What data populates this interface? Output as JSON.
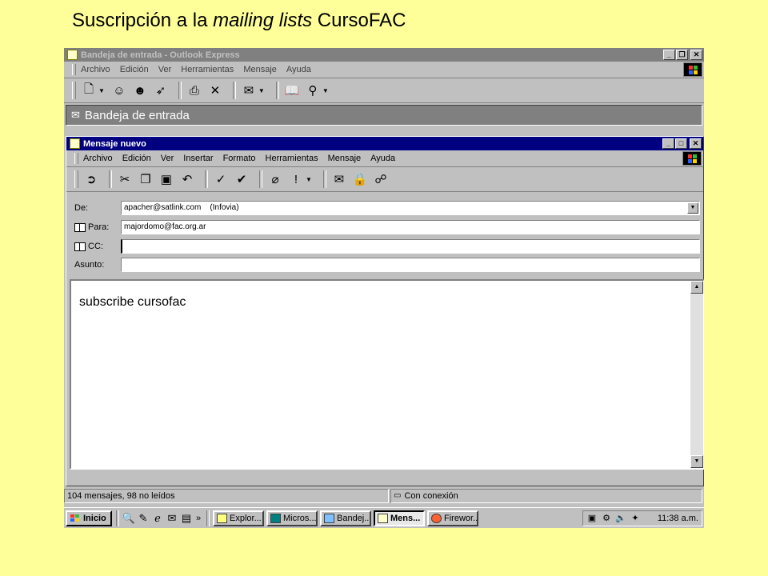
{
  "slide": {
    "title_pre": "Suscripción a la ",
    "title_italic": "mailing lists",
    "title_post": " CursoFAC"
  },
  "outer_window": {
    "title": "Bandeja de entrada - Outlook Express",
    "menu": [
      "Archivo",
      "Edición",
      "Ver",
      "Herramientas",
      "Mensaje",
      "Ayuda"
    ],
    "toolbar_icons": [
      "new-message-icon",
      "reply-icon",
      "reply-all-icon",
      "forward-icon",
      "print-icon",
      "delete-icon",
      "send-receive-icon",
      "address-book-icon",
      "find-icon"
    ],
    "folder_title": "Bandeja de entrada"
  },
  "compose_window": {
    "title": "Mensaje nuevo",
    "menu": [
      "Archivo",
      "Edición",
      "Ver",
      "Insertar",
      "Formato",
      "Herramientas",
      "Mensaje",
      "Ayuda"
    ],
    "toolbar_icons": [
      "send-icon",
      "cut-icon",
      "copy-icon",
      "paste-icon",
      "undo-icon",
      "check-names-icon",
      "spelling-icon",
      "attach-icon",
      "priority-icon",
      "sign-icon",
      "encrypt-icon",
      "offline-icon"
    ],
    "fields": {
      "from_label": "De:",
      "from_value": "apacher@satlink.com    (Infovia)",
      "to_label": "Para:",
      "to_value": "majordomo@fac.org.ar",
      "cc_label": "CC:",
      "cc_value": "",
      "subject_label": "Asunto:",
      "subject_value": ""
    },
    "body_text": "subscribe cursofac"
  },
  "status": {
    "messages": "104 mensajes, 98 no leídos",
    "connection": "Con conexión"
  },
  "taskbar": {
    "start_label": "Inicio",
    "chevron": "»",
    "tasks": [
      {
        "label": "Explor...",
        "active": false
      },
      {
        "label": "Micros...",
        "active": false
      },
      {
        "label": "Bandej...",
        "active": false
      },
      {
        "label": "Mens...",
        "active": true
      },
      {
        "label": "Firewor...",
        "active": false
      }
    ],
    "clock": "11:38 a.m."
  },
  "colors": {
    "slide_bg": "#ffff99",
    "window_gray": "#c0c0c0",
    "active_title": "#000080",
    "inactive_title": "#808080"
  }
}
